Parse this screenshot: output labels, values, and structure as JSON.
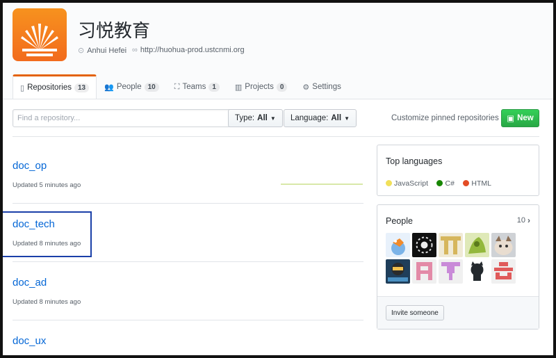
{
  "org": {
    "name": "习悦教育",
    "location": "Anhui Hefei",
    "url": "http://huohua-prod.ustcnmi.org"
  },
  "tabs": [
    {
      "label": "Repositories",
      "count": "13",
      "selected": true
    },
    {
      "label": "People",
      "count": "10"
    },
    {
      "label": "Teams",
      "count": "1"
    },
    {
      "label": "Projects",
      "count": "0"
    },
    {
      "label": "Settings"
    }
  ],
  "toolbar": {
    "search_placeholder": "Find a repository...",
    "type_label": "Type:",
    "type_value": "All",
    "language_label": "Language:",
    "language_value": "All",
    "customize_label": "Customize pinned repositories",
    "new_label": "New"
  },
  "repos": [
    {
      "name": "doc_op",
      "updated": "Updated 5 minutes ago"
    },
    {
      "name": "doc_tech",
      "updated": "Updated 8 minutes ago"
    },
    {
      "name": "doc_ad",
      "updated": "Updated 8 minutes ago"
    },
    {
      "name": "doc_ux",
      "updated": ""
    }
  ],
  "top_languages": {
    "title": "Top languages",
    "items": [
      {
        "name": "JavaScript",
        "color": "#f1e05a"
      },
      {
        "name": "C#",
        "color": "#178600"
      },
      {
        "name": "HTML",
        "color": "#e34c26"
      }
    ]
  },
  "people": {
    "title": "People",
    "count": "10",
    "invite_label": "Invite someone"
  },
  "colors": {
    "accent_tab": "#e36209",
    "link": "#0366d6",
    "new_button": "#28a745",
    "highlight_box": "#1a3fa8"
  }
}
